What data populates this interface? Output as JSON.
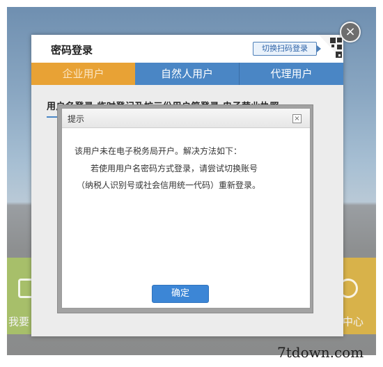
{
  "login_card": {
    "title": "密码登录",
    "qr_switch_label": "切换扫码登录",
    "close_symbol": "×",
    "tabs": [
      {
        "label": "企业用户",
        "active": true
      },
      {
        "label": "自然人用户",
        "active": false
      },
      {
        "label": "代理用户",
        "active": false
      }
    ],
    "sub_tabs_text": "用户名登录   临时登记及扩三份用户简登录   电子营业执照"
  },
  "background": {
    "left_partial_text": "我要",
    "right_partial_text": "中心"
  },
  "dialog": {
    "title": "提示",
    "close_symbol": "×",
    "message_line1": "该用户未在电子税务局开户。解决方法如下：",
    "message_line2": "若使用用户名密码方式登录，请尝试切换账号",
    "message_line3": "（纳税人识别号或社会信用统一代码）重新登录。",
    "confirm_label": "确定"
  },
  "watermark": "7tdown.com",
  "colors": {
    "tab_active": "#e8a235",
    "tab_inactive": "#4a86c5",
    "confirm_button": "#3c86d6"
  }
}
